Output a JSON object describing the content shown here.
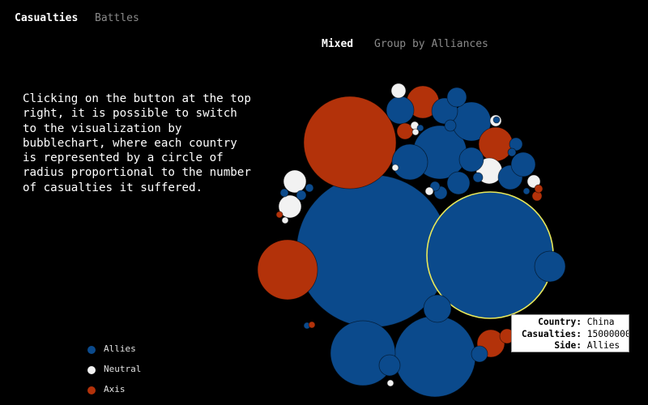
{
  "nav": {
    "tabs": [
      {
        "label": "Casualties",
        "active": true
      },
      {
        "label": "Battles",
        "active": false
      }
    ]
  },
  "view_modes": [
    {
      "label": "Mixed",
      "active": true
    },
    {
      "label": "Group by Alliances",
      "active": false
    }
  ],
  "description": "Clicking on the button at the top right, it is possible to switch to the visualization by bubblechart, where each country is represented by a circle of radius proportional to the number of casualties it suffered.",
  "colors": {
    "allies": "#0b4a8c",
    "neutral": "#f2f2f2",
    "axis": "#b3320a",
    "highlight": "#e8e85a",
    "background": "#000000"
  },
  "legend": [
    {
      "label": "Allies",
      "side": "allies"
    },
    {
      "label": "Neutral",
      "side": "neutral"
    },
    {
      "label": "Axis",
      "side": "axis"
    }
  ],
  "tooltip": {
    "country_key": "Country:",
    "country_value": "China",
    "casualties_key": "Casualties:",
    "casualties_value": "15000000",
    "side_key": "Side:",
    "side_value": "Allies"
  },
  "chart_data": {
    "type": "bubble",
    "highlighted_country": "China",
    "note": "",
    "bubbles": [
      {
        "side": "allies",
        "highlighted": false
      },
      {
        "side": "allies",
        "highlighted": true
      },
      {
        "side": "axis",
        "highlighted": false
      },
      {
        "side": "axis",
        "highlighted": false
      },
      {
        "side": "allies",
        "highlighted": false
      },
      {
        "side": "allies",
        "highlighted": false
      },
      {
        "side": "allies",
        "highlighted": false
      },
      {
        "side": "allies",
        "highlighted": false
      },
      {
        "side": "allies",
        "highlighted": false
      },
      {
        "side": "axis",
        "highlighted": false
      },
      {
        "side": "axis",
        "highlighted": false
      },
      {
        "side": "allies",
        "highlighted": false
      },
      {
        "side": "allies",
        "highlighted": false
      },
      {
        "side": "allies",
        "highlighted": false
      },
      {
        "side": "allies",
        "highlighted": false
      },
      {
        "side": "allies",
        "highlighted": false
      },
      {
        "side": "allies",
        "highlighted": false
      },
      {
        "side": "allies",
        "highlighted": false
      },
      {
        "side": "allies",
        "highlighted": false
      },
      {
        "side": "allies",
        "highlighted": false
      },
      {
        "side": "allies",
        "highlighted": false
      },
      {
        "side": "allies",
        "highlighted": false
      },
      {
        "side": "allies",
        "highlighted": false
      },
      {
        "side": "allies",
        "highlighted": false
      },
      {
        "side": "allies",
        "highlighted": false
      },
      {
        "side": "allies",
        "highlighted": false
      },
      {
        "side": "allies",
        "highlighted": false
      },
      {
        "side": "allies",
        "highlighted": false
      },
      {
        "side": "allies",
        "highlighted": false
      },
      {
        "side": "allies",
        "highlighted": false
      },
      {
        "side": "allies",
        "highlighted": false
      },
      {
        "side": "allies",
        "highlighted": false
      },
      {
        "side": "allies",
        "highlighted": false
      },
      {
        "side": "allies",
        "highlighted": false
      },
      {
        "side": "allies",
        "highlighted": false
      },
      {
        "side": "axis",
        "highlighted": false
      },
      {
        "side": "axis",
        "highlighted": false
      },
      {
        "side": "axis",
        "highlighted": false
      },
      {
        "side": "axis",
        "highlighted": false
      },
      {
        "side": "axis",
        "highlighted": false
      },
      {
        "side": "axis",
        "highlighted": false
      },
      {
        "side": "axis",
        "highlighted": false
      },
      {
        "side": "neutral",
        "highlighted": false
      },
      {
        "side": "neutral",
        "highlighted": false
      },
      {
        "side": "neutral",
        "highlighted": false
      },
      {
        "side": "neutral",
        "highlighted": false
      },
      {
        "side": "neutral",
        "highlighted": false
      },
      {
        "side": "neutral",
        "highlighted": false
      },
      {
        "side": "neutral",
        "highlighted": false
      },
      {
        "side": "neutral",
        "highlighted": false
      },
      {
        "side": "neutral",
        "highlighted": false
      },
      {
        "side": "neutral",
        "highlighted": false
      },
      {
        "side": "neutral",
        "highlighted": false
      },
      {
        "side": "neutral",
        "highlighted": false
      }
    ]
  }
}
